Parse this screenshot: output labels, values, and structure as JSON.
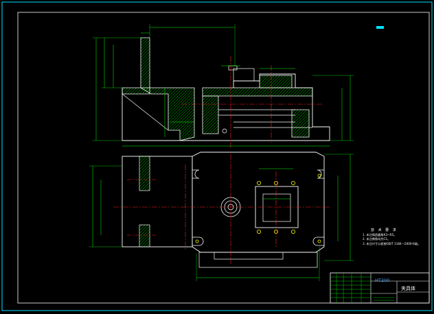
{
  "window": {
    "background": "#000000"
  },
  "colors": {
    "border": "#00e5ff",
    "outline": "#ffffff",
    "dimension": "#00ff00",
    "centerline": "#ff2020",
    "hatch": "#00ff00",
    "hole": "#ffff00",
    "material_text": "#4aa8ff"
  },
  "icons": {
    "scale_badge": "scale-badge-icon"
  },
  "drawing": {
    "technical_notes": {
      "title": "技 术 要 求",
      "items": [
        "1. 未注铸造圆角R3~R5。",
        "2. 未注倒角均为C1。",
        "3. 未注尺寸公差按GB/T 1184—2000-K级。"
      ]
    },
    "title_block": {
      "material": "HT200",
      "part_name": "夹具体"
    }
  }
}
